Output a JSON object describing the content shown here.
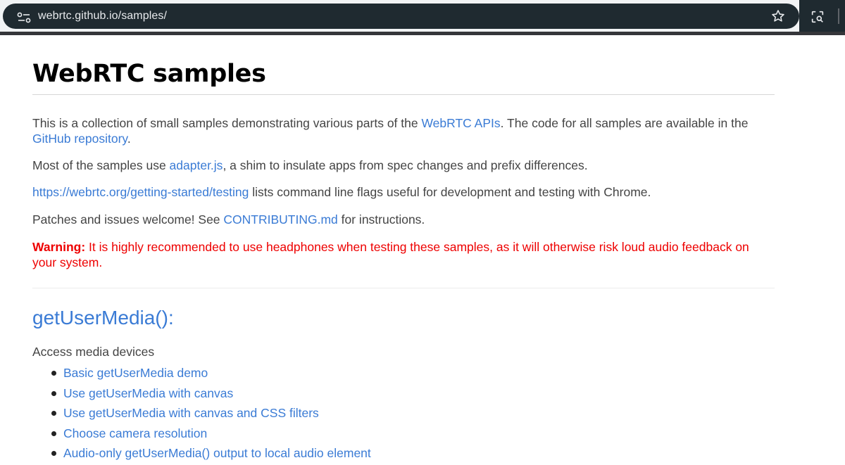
{
  "browser": {
    "url": "webrtc.github.io/samples/",
    "icons": [
      "site-info-icon",
      "star-icon",
      "lens-icon"
    ]
  },
  "page": {
    "title": "WebRTC samples",
    "intro": {
      "before": "This is a collection of small samples demonstrating various parts of the ",
      "link1": "WebRTC APIs",
      "middle": ". The code for all samples are available in the ",
      "link2": "GitHub repository",
      "after": "."
    },
    "adapter": {
      "before": "Most of the samples use ",
      "link": "adapter.js",
      "after": ", a shim to insulate apps from spec changes and prefix differences."
    },
    "testing": {
      "link": "https://webrtc.org/getting-started/testing",
      "after": " lists command line flags useful for development and testing with Chrome."
    },
    "patches": {
      "before": "Patches and issues welcome! See ",
      "link": "CONTRIBUTING.md",
      "after": " for instructions."
    },
    "warning": {
      "label": "Warning:",
      "text": " It is highly recommended to use headphones when testing these samples, as it will otherwise risk loud audio feedback on your system."
    },
    "section": {
      "title": "getUserMedia():",
      "description": "Access media devices",
      "items": [
        "Basic getUserMedia demo",
        "Use getUserMedia with canvas",
        "Use getUserMedia with canvas and CSS filters",
        "Choose camera resolution",
        "Audio-only getUserMedia() output to local audio element"
      ]
    }
  },
  "colors": {
    "link": "#3a7bd5",
    "warning": "#ee0000",
    "omnibox": "#1f2a30"
  }
}
